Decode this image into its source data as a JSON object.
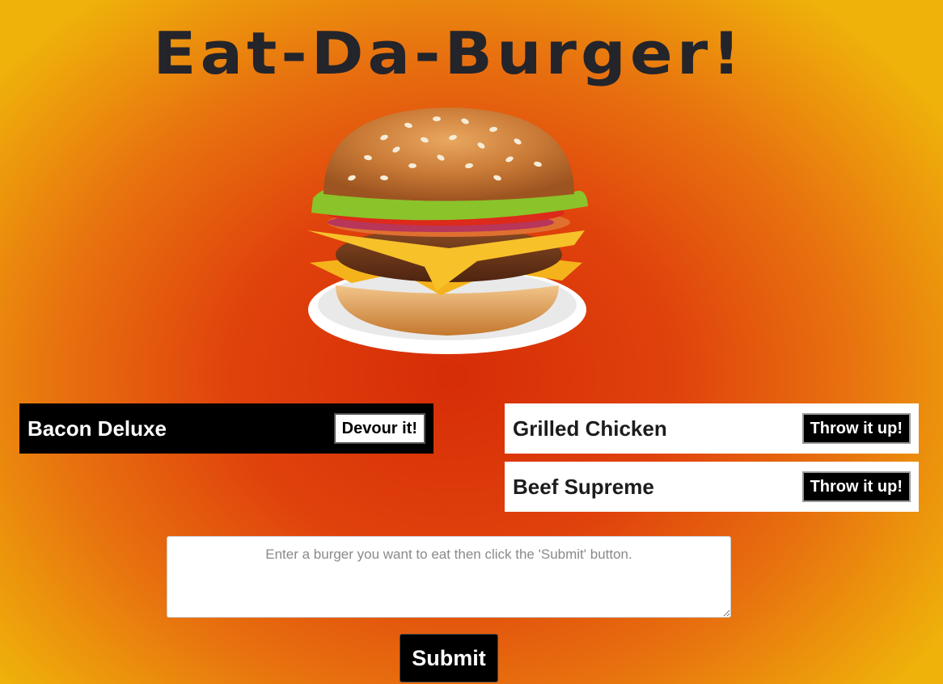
{
  "header": {
    "title": "Eat-Da-Burger!"
  },
  "hero": {
    "image_icon": "burger-illustration"
  },
  "uneaten": [
    {
      "name": "Bacon Deluxe",
      "button_label": "Devour it!"
    }
  ],
  "devoured": [
    {
      "name": "Grilled Chicken",
      "button_label": "Throw it up!"
    },
    {
      "name": "Beef Supreme",
      "button_label": "Throw it up!"
    }
  ],
  "form": {
    "placeholder": "Enter a burger you want to eat then click the 'Submit' button.",
    "value": "",
    "submit_label": "Submit"
  },
  "colors": {
    "background_center": "#d62d07",
    "background_edge": "#efb20a",
    "title": "#24242b"
  }
}
